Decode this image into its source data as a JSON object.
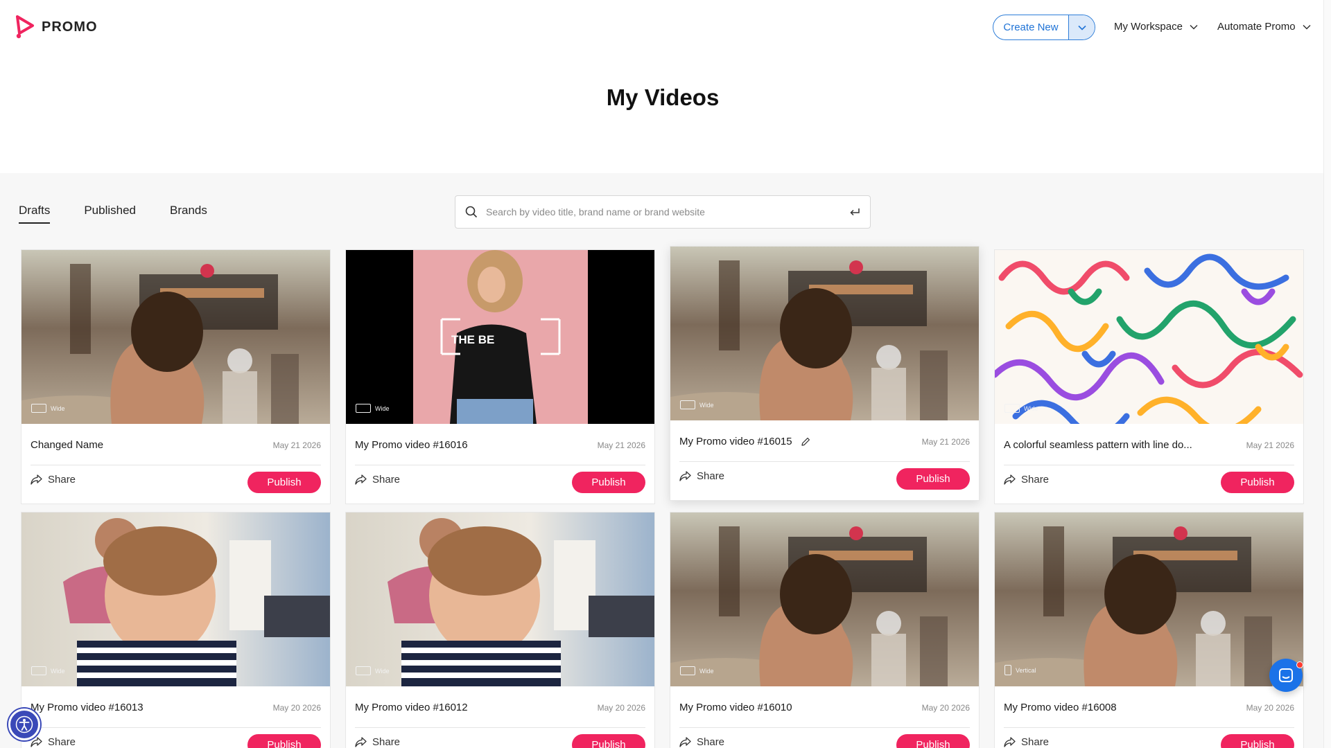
{
  "header": {
    "logo_text": "PROMO",
    "create_new_label": "Create New",
    "workspace_label": "My Workspace",
    "automate_label": "Automate Promo",
    "accent_color": "#f0245f",
    "link_color": "#1f73d6"
  },
  "page_title": "My Videos",
  "tabs": [
    {
      "label": "Drafts",
      "active": true
    },
    {
      "label": "Published",
      "active": false
    },
    {
      "label": "Brands",
      "active": false
    }
  ],
  "search": {
    "placeholder": "Search by video title, brand name or brand website",
    "value": ""
  },
  "actions": {
    "share_label": "Share",
    "publish_label": "Publish"
  },
  "videos": [
    {
      "title": "Changed Name",
      "date": "May 21 2026",
      "format": "Wide",
      "thumbnail": "festival-crowd"
    },
    {
      "title": "My Promo video #16016",
      "date": "May 21 2026",
      "format": "Wide",
      "thumbnail": "model-pink-wall",
      "overlay_text": "THE BE"
    },
    {
      "title": "My Promo video #16015",
      "date": "May 21 2026",
      "format": "Wide",
      "thumbnail": "festival-crowd",
      "hovered": true,
      "edit_icon": "pencil-icon"
    },
    {
      "title": "A colorful seamless pattern with line do...",
      "date": "May 21 2026",
      "format": "Wide",
      "thumbnail": "colorful-line-pattern"
    },
    {
      "title": "My Promo video #16013",
      "date": "May 20 2026",
      "format": "Wide",
      "thumbnail": "child-and-father"
    },
    {
      "title": "My Promo video #16012",
      "date": "May 20 2026",
      "format": "Wide",
      "thumbnail": "child-and-father"
    },
    {
      "title": "My Promo video #16010",
      "date": "May 20 2026",
      "format": "Wide",
      "thumbnail": "festival-crowd"
    },
    {
      "title": "My Promo video #16008",
      "date": "May 20 2026",
      "format": "Vertical",
      "thumbnail": "festival-crowd"
    }
  ],
  "floating": {
    "chat_icon": "chat-icon",
    "accessibility_icon": "accessibility-icon"
  }
}
